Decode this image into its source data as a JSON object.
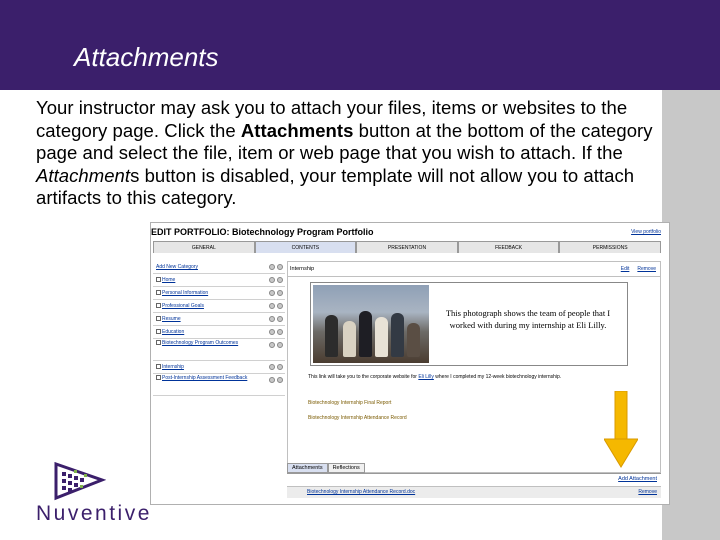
{
  "slide": {
    "title": "Attachments",
    "paragraph": {
      "part1": "Your instructor may ask you to attach your files, items or websites to the category page.  Click the ",
      "bold1": "Attachments",
      "part2": " button at the bottom of the category page and select the file, item or web page that you wish to attach.  If the ",
      "italic1": "Attachment",
      "part3": "s button is disabled, your template will not allow you to attach artifacts to this category."
    }
  },
  "screenshot": {
    "title": "EDIT PORTFOLIO: Biotechnology Program Portfolio",
    "view_link": "View portfolio",
    "tabs": [
      "GENERAL",
      "CONTENTS",
      "PRESENTATION",
      "FEEDBACK",
      "PERMISSIONS"
    ],
    "nav": {
      "add_category": "Add New Category",
      "items": [
        {
          "label": "Home",
          "tall": false
        },
        {
          "label": "Personal Information",
          "tall": false
        },
        {
          "label": "Professional Goals",
          "tall": false
        },
        {
          "label": "Resume",
          "tall": false
        },
        {
          "label": "Education",
          "tall": false
        },
        {
          "label": "Biotechnology Program Outcomes",
          "tall": true
        },
        {
          "label": "Internship",
          "tall": false
        },
        {
          "label": "Post-Internship Assessment Feedback",
          "tall": true
        }
      ]
    },
    "content": {
      "header": "Internship",
      "edit_link": "Edit",
      "remove_link": "Remove",
      "caption": "This photograph shows the team of people that I worked with during my internship at Eli Lilly.",
      "link_text_before": "This link will take you to the corporate website for ",
      "link_name": "Eli Lilly",
      "link_text_after": " where I completed my 12-week biotechnology internship.",
      "reports": [
        "Biotechnology Internship Final Report",
        "Biotechnology Internship Attendance Record"
      ]
    },
    "attach_tabs": [
      "Attachments",
      "Reflections"
    ],
    "add_attachment": "Add Attachment",
    "bottom_link": "Biotechnology Internship Attendance Record.doc",
    "bottom_right": "Remove"
  },
  "logo": {
    "text": "Nuventive"
  },
  "colors": {
    "title_bar": "#3b1f6b",
    "right_strip": "#c8c8c8",
    "arrow": "#f5b800"
  }
}
